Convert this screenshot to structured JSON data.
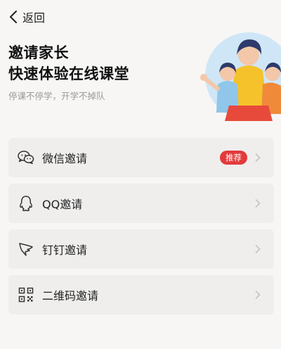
{
  "header": {
    "back_label": "返回"
  },
  "hero": {
    "title_line1": "邀请家长",
    "title_line2": "快速体验在线课堂",
    "subtitle": "停课不停学，开学不掉队"
  },
  "invite_options": [
    {
      "label": "微信邀请",
      "icon": "wechat-icon",
      "badge": "推荐"
    },
    {
      "label": "QQ邀请",
      "icon": "qq-icon"
    },
    {
      "label": "钉钉邀请",
      "icon": "dingtalk-icon"
    },
    {
      "label": "二维码邀请",
      "icon": "qrcode-icon"
    }
  ],
  "colors": {
    "badge": "#e23b3b",
    "card_bg": "#efeeed",
    "page_bg": "#f7f6f5"
  }
}
